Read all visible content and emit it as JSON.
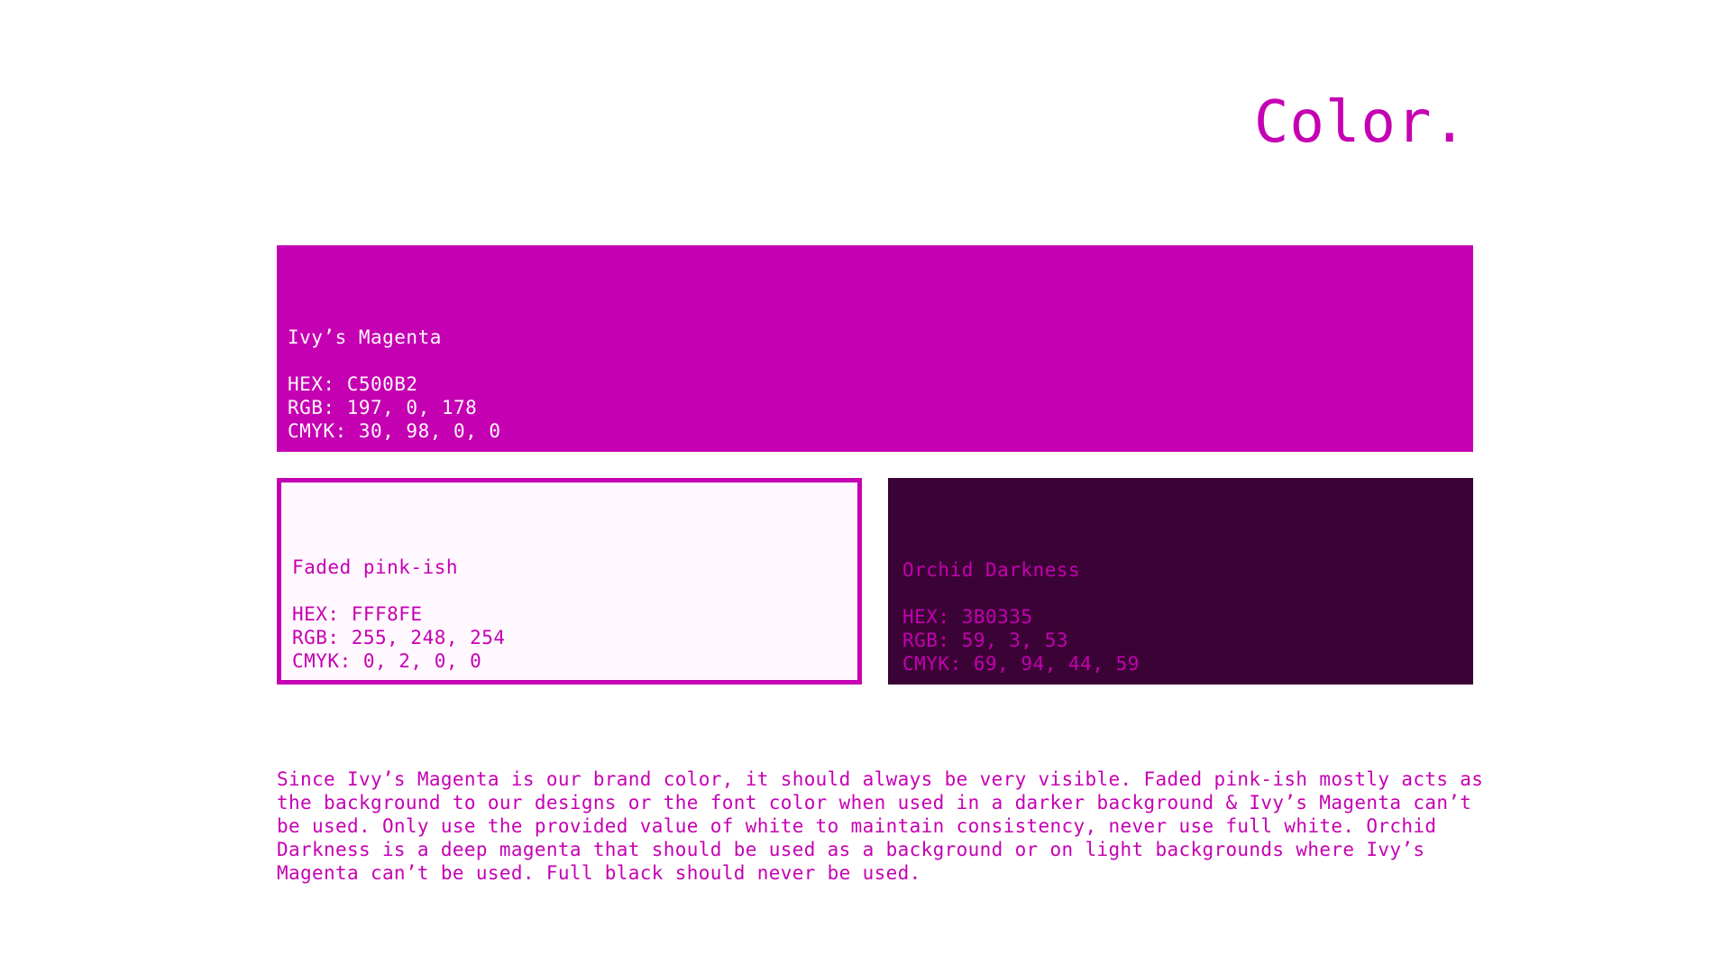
{
  "title": "Color.",
  "swatches": {
    "primary": {
      "name": "Ivy’s Magenta",
      "hex": "HEX: C500B2",
      "rgb": "RGB: 197, 0, 178",
      "cmyk": "CMYK: 30, 98, 0, 0",
      "color": "#C500B2"
    },
    "light": {
      "name": "Faded pink-ish",
      "hex": "HEX: FFF8FE",
      "rgb": "RGB: 255, 248, 254",
      "cmyk": "CMYK: 0, 2, 0, 0",
      "color": "#FFF8FE"
    },
    "dark": {
      "name": "Orchid Darkness",
      "hex": "HEX: 3B0335",
      "rgb": "RGB: 59, 3, 53",
      "cmyk": "CMYK: 69, 94, 44, 59",
      "color": "#3B0335"
    }
  },
  "description": "Since Ivy’s Magenta is our brand color, it should always be very visible. Faded pink-ish mostly acts as the background to our designs or the font color when used in a darker background & Ivy’s Magenta can’t be used. Only use the provided value of white to maintain consistency, never use full white. Orchid Darkness is a deep magenta that should be used as a background or on light backgrounds where Ivy’s Magenta can’t be used. Full black should never be used."
}
